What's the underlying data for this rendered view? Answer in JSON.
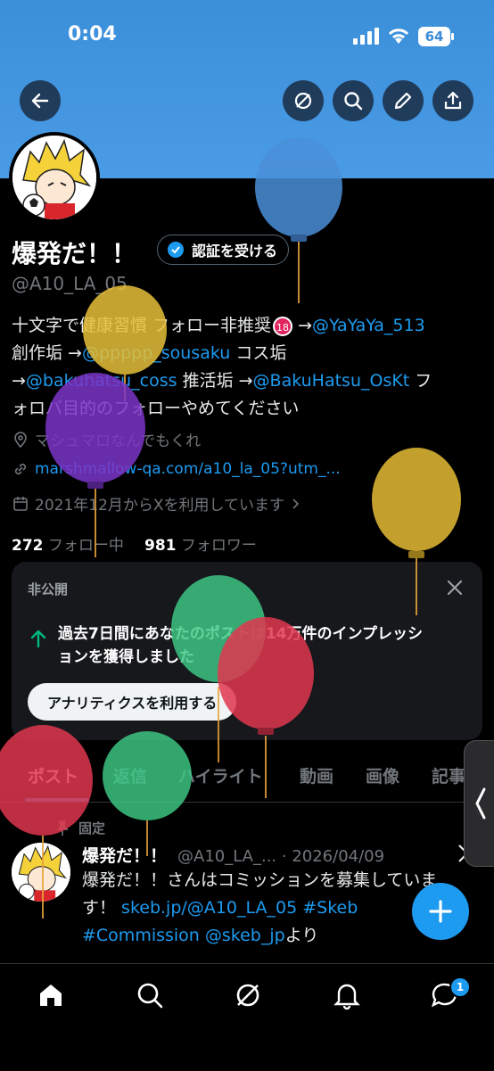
{
  "status_bar": {
    "time": "0:04",
    "battery": "64"
  },
  "profile": {
    "name": "爆発だ！！",
    "verify_label": "認証を受ける",
    "handle": "@A10_LA_05",
    "bio": {
      "line1_prefix": "十文字で健康習慣 フォロー非推奨",
      "line1_arrow": " →",
      "line1_link": "@YaYaYa_513",
      "line2_prefix": "創作垢 →",
      "line2_link": "@ppppp_sousaku",
      "line2_suffix": " コス垢",
      "line3_arrow": "→",
      "line3_link1": "@bakuhatsu_coss",
      "line3_mid": " 推活垢 →",
      "line3_link2": "@BakuHatsu_OsKt",
      "line3_suffix": " フ",
      "line4": "ォロバ目的のフォローやめてください"
    },
    "location": "マシュマロなんでもくれ",
    "website": "marshmallow-qa.com/a10_la_05?utm_...",
    "joined": "2021年12月からXを利用しています",
    "following_count": "272",
    "following_label": "フォロー中",
    "followers_count": "981",
    "followers_label": "フォロワー"
  },
  "private_card": {
    "title": "非公開",
    "message_line1": "過去7日間にあなたのポストは14万件のインプレッシ",
    "message_line2": "ョンを獲得しました",
    "button": "アナリティクスを利用する"
  },
  "tabs": [
    "ポスト",
    "返信",
    "ハイライト",
    "動画",
    "画像",
    "記事"
  ],
  "pinned_post": {
    "pinned_label": "固定",
    "author": "爆発だ！！",
    "handle_date": "@A10_LA_... · 2026/04/09",
    "text_line1": "爆発だ！！さんはコミッションを募集していま",
    "text_line2_prefix": "す！ ",
    "text_line2_link": "skeb.jp/@A10_LA_05 #Skeb",
    "text_line3_link": "#Commission @skeb_jp",
    "text_line3_suffix": "より"
  },
  "bottom_nav": {
    "messages_badge": "1"
  },
  "colors": {
    "accent": "#1d9bf0",
    "banner": "#4a9be6",
    "background": "#000000"
  }
}
